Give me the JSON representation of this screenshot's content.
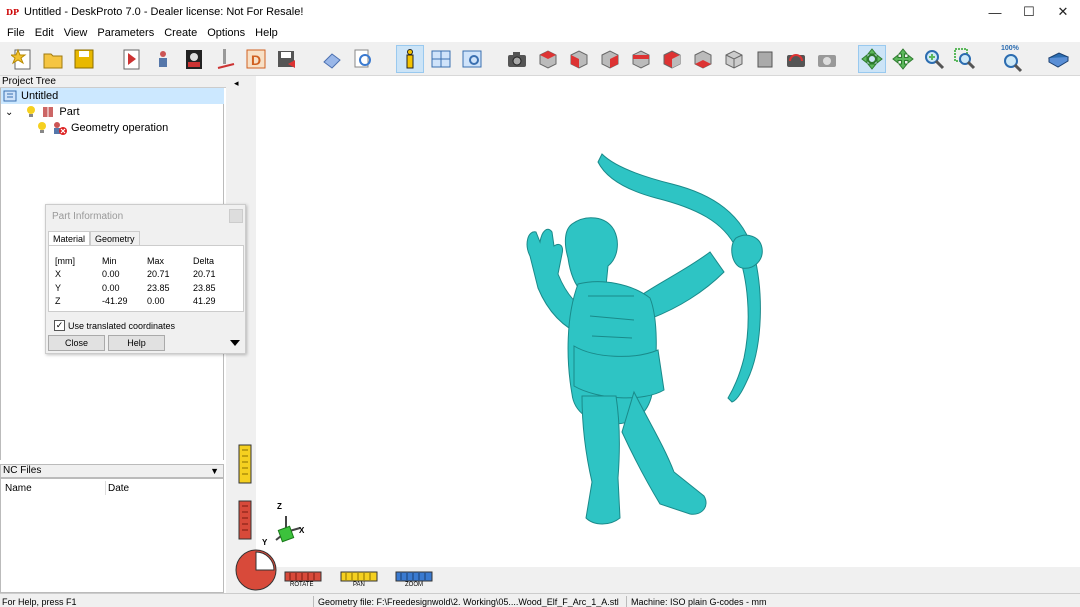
{
  "window": {
    "title": "Untitled - DeskProto 7.0 - Dealer license: Not For Resale!",
    "app_icon_text": "DP",
    "minimize": "—",
    "maximize": "☐",
    "close": "✕"
  },
  "menu": [
    "File",
    "Edit",
    "View",
    "Parameters",
    "Create",
    "Options",
    "Help"
  ],
  "toolbar": {
    "zoom_label": "100%",
    "groups": [
      "file",
      "operations",
      "view",
      "camera-views",
      "navigation",
      "zoom",
      "help"
    ]
  },
  "project_tree": {
    "header": "Project Tree",
    "root": "Untitled",
    "part": "Part",
    "operation": "Geometry operation",
    "expand_glyph": "⌄"
  },
  "nc_files": {
    "header": "NC Files",
    "columns": [
      "Name",
      "Date"
    ],
    "dropdown_glyph": "▼"
  },
  "part_info": {
    "title": "Part Information",
    "tabs": [
      "Material",
      "Geometry"
    ],
    "header": [
      "[mm]",
      "Min",
      "Max",
      "Delta"
    ],
    "rows": [
      [
        "X",
        "0.00",
        "20.71",
        "20.71"
      ],
      [
        "Y",
        "0.00",
        "23.85",
        "23.85"
      ],
      [
        "Z",
        "-41.29",
        "0.00",
        "41.29"
      ]
    ],
    "checkbox_label": "Use translated coordinates",
    "checkbox_checked": "✓",
    "close_button": "Close",
    "help_button": "Help"
  },
  "viewport": {
    "model_color": "#2ec4c4",
    "axes": {
      "x": "X",
      "y": "Y",
      "z": "Z"
    },
    "controls": [
      "ROTATE",
      "PAN",
      "ZOOM"
    ],
    "collapse_glyph": "◂"
  },
  "status": {
    "help": "For Help, press F1",
    "geometry_file": "Geometry file: F:\\Freedesignwold\\2. Working\\05....Wood_Elf_F_Arc_1_A.stl",
    "machine": "Machine: ISO plain G-codes - mm"
  }
}
